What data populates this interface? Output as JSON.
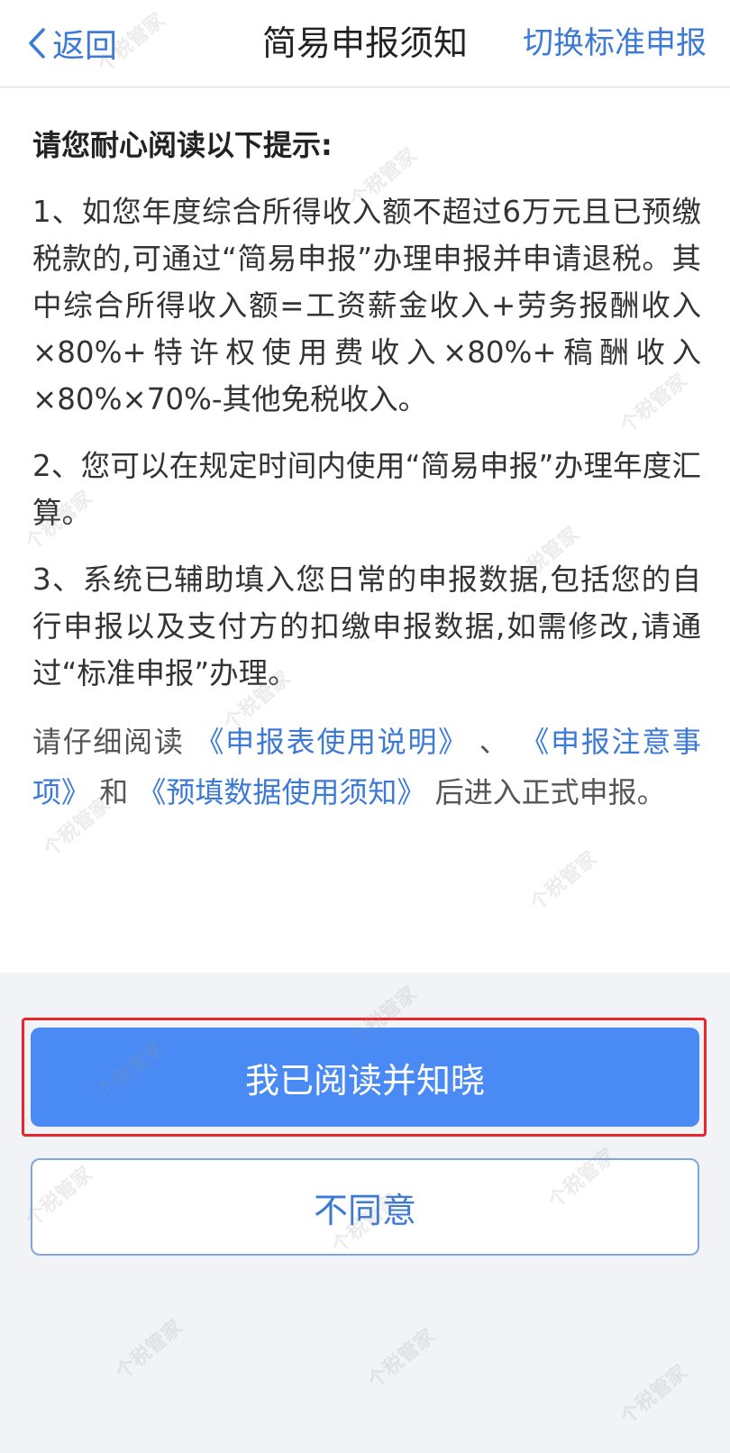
{
  "nav": {
    "back_label": "返回",
    "title": "简易申报须知",
    "switch_label": "切换标准申报"
  },
  "content": {
    "heading": "请您耐心阅读以下提示:",
    "items": [
      "1、如您年度综合所得收入额不超过6万元且已预缴税款的,可通过“简易申报”办理申报并申请退税。其中综合所得收入额=工资薪金收入+劳务报酬收入×80%+特许权使用费收入×80%+稿酬收入×80%×70%-其他免税收入。",
      "2、您可以在规定时间内使用“简易申报”办理年度汇算。",
      "3、系统已辅助填入您日常的申报数据,包括您的自行申报以及支付方的扣缴申报数据,如需修改,请通过“标准申报”办理。"
    ],
    "notice": {
      "prefix": "请仔细阅读",
      "link1": "《申报表使用说明》",
      "sep": "、",
      "link2": "《申报注意事项》",
      "and": "和",
      "link3": "《预填数据使用须知》",
      "suffix": "后进入正式申报。"
    }
  },
  "actions": {
    "confirm_label": "我已阅读并知晓",
    "disagree_label": "不同意"
  },
  "watermark_text": "个税管家",
  "colors": {
    "accent": "#3d7ad6",
    "primary_button": "#4a8af4",
    "highlight_border": "#e8262c",
    "page_bg": "#f2f3f7"
  },
  "icons": {
    "back": "chevron-left-icon"
  }
}
